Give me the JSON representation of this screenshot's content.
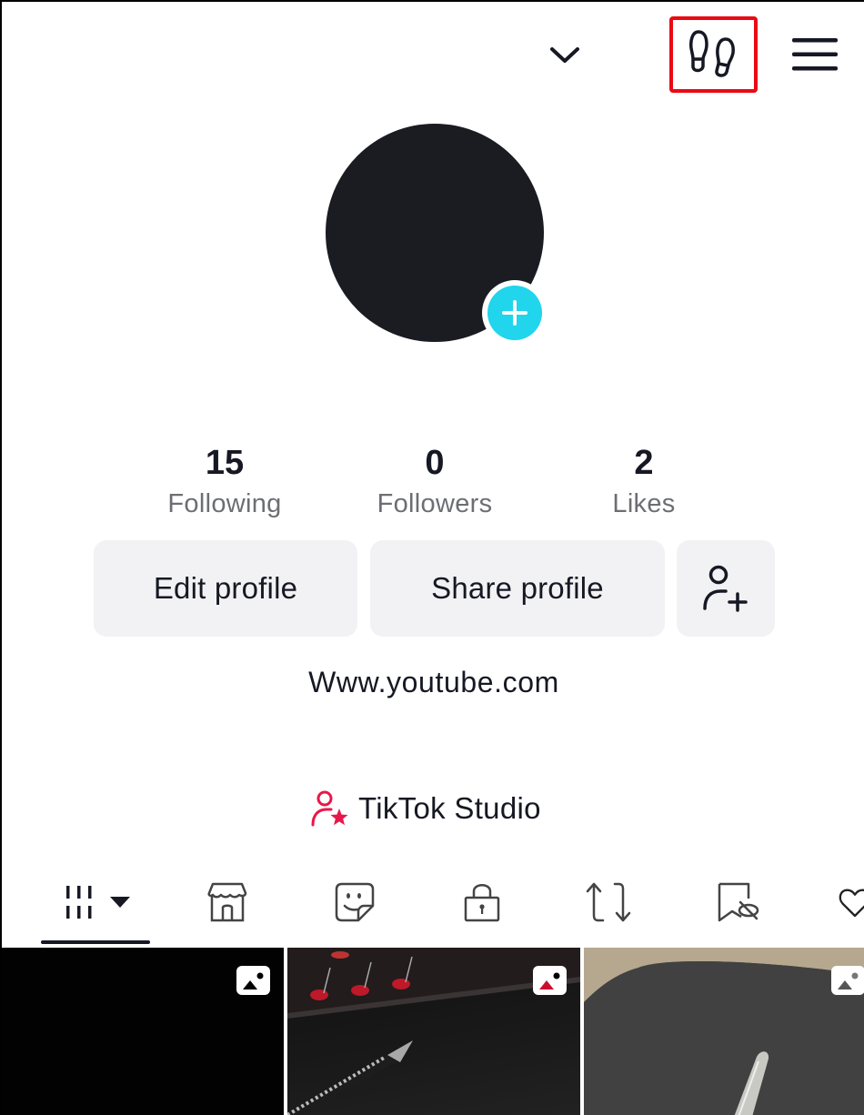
{
  "header": {
    "account_switcher_icon": "chevron-down-icon",
    "footprints_icon": "footprints-icon",
    "footprints_highlight_color": "#ea0a14",
    "menu_icon": "hamburger-menu-icon"
  },
  "profile": {
    "avatar_add_icon": "plus-icon",
    "avatar_add_color": "#20d5ec",
    "stats": [
      {
        "value": "15",
        "label": "Following"
      },
      {
        "value": "0",
        "label": "Followers"
      },
      {
        "value": "2",
        "label": "Likes"
      }
    ],
    "buttons": {
      "edit": "Edit profile",
      "share": "Share profile",
      "add_friends_icon": "add-user-icon"
    },
    "bio": "Www.youtube.com",
    "studio": {
      "label": "TikTok Studio",
      "icon": "creator-star-icon",
      "accent": "#e8174a"
    }
  },
  "tabs": [
    {
      "name": "videos",
      "icon": "grid-bars-icon",
      "has_dropdown": true,
      "active": true
    },
    {
      "name": "shop",
      "icon": "storefront-icon"
    },
    {
      "name": "stickers",
      "icon": "sticker-icon"
    },
    {
      "name": "private",
      "icon": "lock-icon"
    },
    {
      "name": "reposts",
      "icon": "repost-icon"
    },
    {
      "name": "favorites",
      "icon": "bookmark-hidden-icon"
    },
    {
      "name": "liked",
      "icon": "heart-icon"
    }
  ],
  "grid": [
    {
      "type": "photo",
      "badge_icon": "photo-icon",
      "description": "dark image"
    },
    {
      "type": "photo",
      "badge_icon": "photo-icon",
      "description": "pen on dark keyboard with red lights"
    },
    {
      "type": "photo",
      "badge_icon": "photo-icon",
      "description": "pen on gray mat"
    }
  ]
}
